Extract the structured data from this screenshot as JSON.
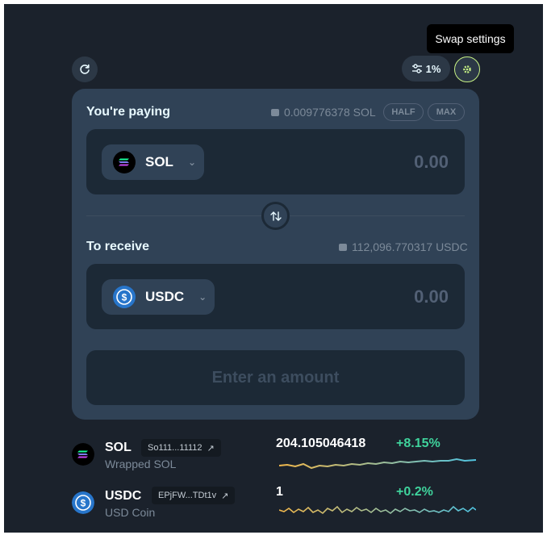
{
  "tooltip": {
    "text": "Swap settings"
  },
  "header": {
    "refresh_icon": "refresh-icon",
    "slippage": {
      "icon": "sliders-icon",
      "value": "1%"
    },
    "settings_icon": "gear-icon"
  },
  "paying": {
    "label": "You're paying",
    "balance": "0.009776378 SOL",
    "half_label": "HALF",
    "max_label": "MAX",
    "token": "SOL",
    "amount_placeholder": "0.00"
  },
  "receiving": {
    "label": "To receive",
    "balance": "112,096.770317 USDC",
    "token": "USDC",
    "amount_placeholder": "0.00"
  },
  "cta": {
    "label": "Enter an amount"
  },
  "token_info": [
    {
      "symbol": "SOL",
      "name": "Wrapped SOL",
      "address": "So111...11112",
      "price": "204.105046418",
      "change": "+8.15%"
    },
    {
      "symbol": "USDC",
      "name": "USD Coin",
      "address": "EPjFW...TDt1v",
      "price": "1",
      "change": "+0.2%"
    }
  ],
  "colors": {
    "background": "#1b222c",
    "panel": "#304256",
    "input": "#1c2936",
    "accent": "#c7f284",
    "positive": "#3fd39c",
    "spark_start": "#f2b84b",
    "spark_end": "#4fc3e0"
  }
}
